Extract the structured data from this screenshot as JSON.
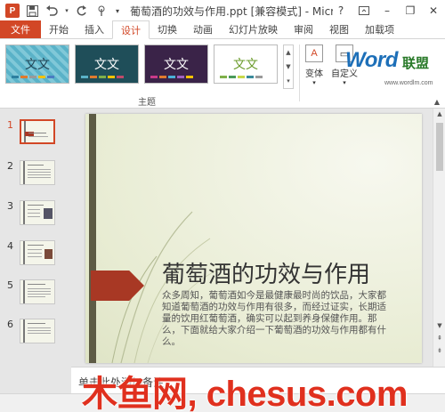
{
  "window": {
    "title": "葡萄酒的功效与作用.ppt [兼容模式] - Micros...",
    "help": "?",
    "minimize": "–",
    "restore": "❐",
    "close": "✕"
  },
  "quick_access": {
    "app_icon": "P",
    "save_icon": "save-icon",
    "undo_icon": "undo-icon",
    "redo_icon": "redo-icon",
    "touch_icon": "touch-mode-icon"
  },
  "tabs": [
    {
      "label": "文件"
    },
    {
      "label": "开始"
    },
    {
      "label": "插入"
    },
    {
      "label": "设计",
      "active": true
    },
    {
      "label": "切换"
    },
    {
      "label": "动画"
    },
    {
      "label": "幻灯片放映"
    },
    {
      "label": "审阅"
    },
    {
      "label": "视图"
    },
    {
      "label": "加载项"
    }
  ],
  "ribbon": {
    "themes": [
      {
        "label": "文文"
      },
      {
        "label": "文文"
      },
      {
        "label": "文文"
      },
      {
        "label": "文文"
      }
    ],
    "group_label": "主题",
    "variants_label": "变体",
    "customize_label": "自定义",
    "logo": {
      "word": "Word",
      "cn": "联盟",
      "url": "www.wordlm.com"
    }
  },
  "thumbnails": [
    {
      "num": "1"
    },
    {
      "num": "2"
    },
    {
      "num": "3"
    },
    {
      "num": "4"
    },
    {
      "num": "5"
    },
    {
      "num": "6"
    }
  ],
  "slide": {
    "title": "葡萄酒的功效与作用",
    "body": "众多周知，葡萄酒如今是最健康最时尚的饮品，大家都知道葡萄酒的功效与作用有很多，而经过证实，长期适量的饮用红葡萄酒，确实可以起到养身保健作用。那么，下面就给大家介绍一下葡萄酒的功效与作用都有什么。"
  },
  "notes": {
    "placeholder": "单击此处添加备注"
  },
  "watermark": "木鱼网, chesus.com",
  "colors": {
    "accent": "#d24726",
    "arrow": "#a83824",
    "slide_bar": "#5d5b45"
  }
}
